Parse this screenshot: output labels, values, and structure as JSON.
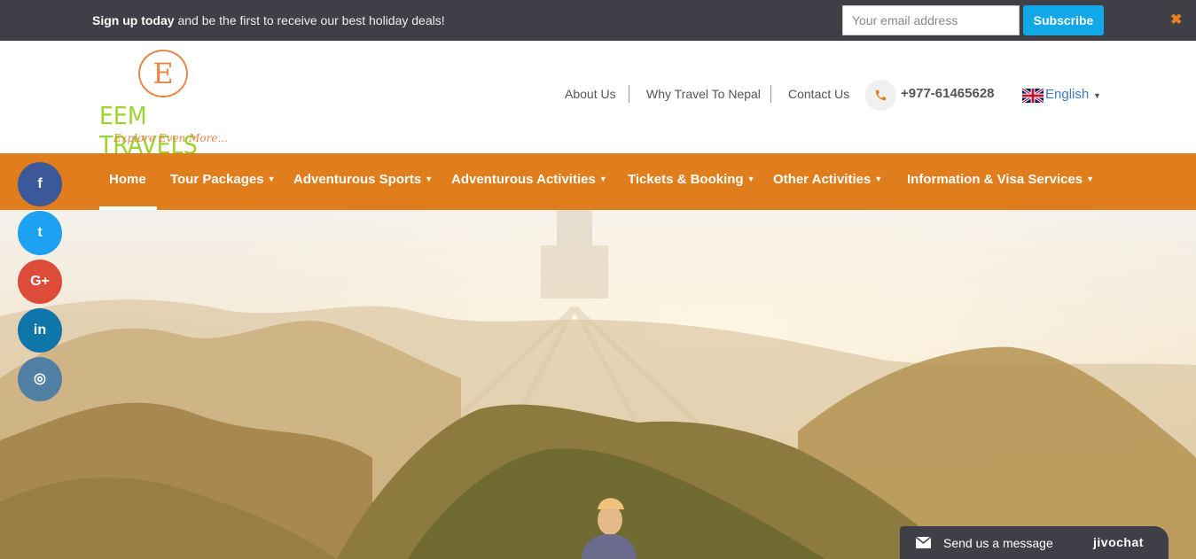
{
  "signup_bar": {
    "message_bold": "Sign up today",
    "message_rest": " and be the first to receive our best holiday deals!",
    "email_placeholder": "Your email address",
    "subscribe_label": "Subscribe",
    "close_label": "✖"
  },
  "logo": {
    "letter": "E",
    "name": "EEM TRAVELS",
    "tagline": "Explore Even More..."
  },
  "top_links": [
    "About Us",
    "Why Travel To Nepal",
    "Contact Us"
  ],
  "phone": "+977-61465628",
  "language": {
    "label": "English",
    "caret": "▼"
  },
  "nav": {
    "items": [
      {
        "label": "Home",
        "dropdown": false
      },
      {
        "label": "Tour Packages",
        "dropdown": true
      },
      {
        "label": "Adventurous Sports",
        "dropdown": true
      },
      {
        "label": "Adventurous Activities",
        "dropdown": true
      },
      {
        "label": "Tickets & Booking",
        "dropdown": true
      },
      {
        "label": "Other Activities",
        "dropdown": true
      },
      {
        "label": "Information & Visa Services",
        "dropdown": true
      }
    ],
    "dropdown_glyph": "▼"
  },
  "social": [
    {
      "name": "facebook",
      "glyph": "f",
      "color": "#3b5998"
    },
    {
      "name": "twitter",
      "glyph": "t",
      "color": "#1da1f2"
    },
    {
      "name": "google-plus",
      "glyph": "G+",
      "color": "#dd4b39"
    },
    {
      "name": "linkedin",
      "glyph": "in",
      "color": "#0e76a8"
    },
    {
      "name": "instagram",
      "glyph": "◎",
      "color": "#517fa4"
    }
  ],
  "chat": {
    "label": "Send us a message",
    "brand": "jivochat"
  },
  "colors": {
    "topbar": "#3f3f48",
    "nav": "#e07d1d",
    "subscribe": "#12a8e8",
    "logo_green": "#9ad42c",
    "logo_orange": "#e8874a"
  }
}
